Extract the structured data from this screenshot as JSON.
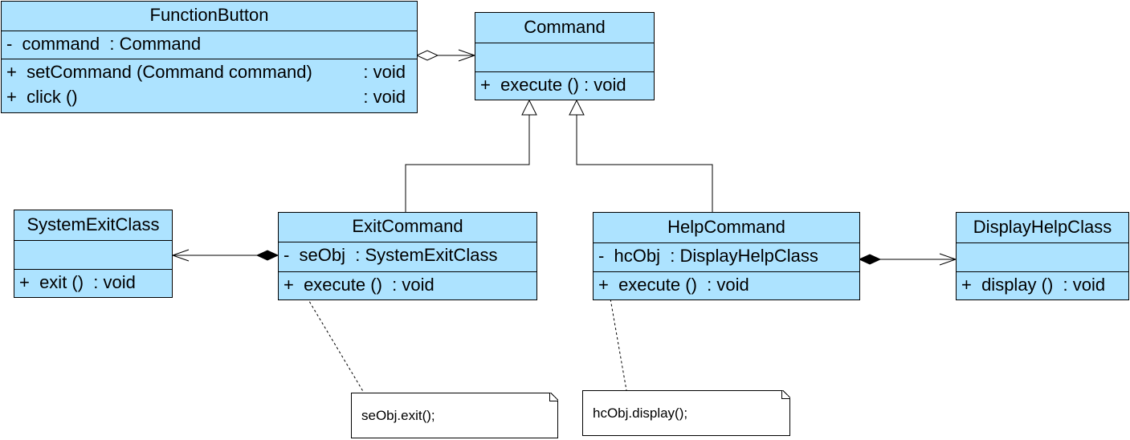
{
  "colors": {
    "class_fill": "#ade3ff",
    "note_fill": "#ffffff",
    "line": "#000000"
  },
  "classes": {
    "function_button": {
      "name": "FunctionButton",
      "attributes": [
        {
          "text": "-  command  : Command",
          "type": ""
        }
      ],
      "operations": [
        {
          "text": "+  setCommand (Command command)",
          "type": ": void"
        },
        {
          "text": "+  click ()",
          "type": ": void"
        }
      ]
    },
    "command": {
      "name": "Command",
      "attributes": [],
      "operations": [
        {
          "text": "+  execute () : void",
          "type": ""
        }
      ]
    },
    "system_exit_class": {
      "name": "SystemExitClass",
      "attributes": [],
      "operations": [
        {
          "text": "+  exit ()  : void",
          "type": ""
        }
      ]
    },
    "exit_command": {
      "name": "ExitCommand",
      "attributes": [
        {
          "text": "-  seObj  : SystemExitClass",
          "type": ""
        }
      ],
      "operations": [
        {
          "text": "+  execute ()  : void",
          "type": ""
        }
      ]
    },
    "help_command": {
      "name": "HelpCommand",
      "attributes": [
        {
          "text": "-  hcObj  : DisplayHelpClass",
          "type": ""
        }
      ],
      "operations": [
        {
          "text": "+  execute ()  : void",
          "type": ""
        }
      ]
    },
    "display_help_class": {
      "name": "DisplayHelpClass",
      "attributes": [],
      "operations": [
        {
          "text": "+  display ()  : void",
          "type": ""
        }
      ]
    }
  },
  "notes": {
    "exit_note": "seObj.exit();",
    "help_note": "hcObj.display();"
  },
  "relationships": [
    {
      "type": "aggregation",
      "from": "FunctionButton",
      "to": "Command"
    },
    {
      "type": "generalization",
      "from": "ExitCommand",
      "to": "Command"
    },
    {
      "type": "generalization",
      "from": "HelpCommand",
      "to": "Command"
    },
    {
      "type": "composition",
      "from": "ExitCommand",
      "to": "SystemExitClass"
    },
    {
      "type": "composition",
      "from": "HelpCommand",
      "to": "DisplayHelpClass"
    }
  ]
}
